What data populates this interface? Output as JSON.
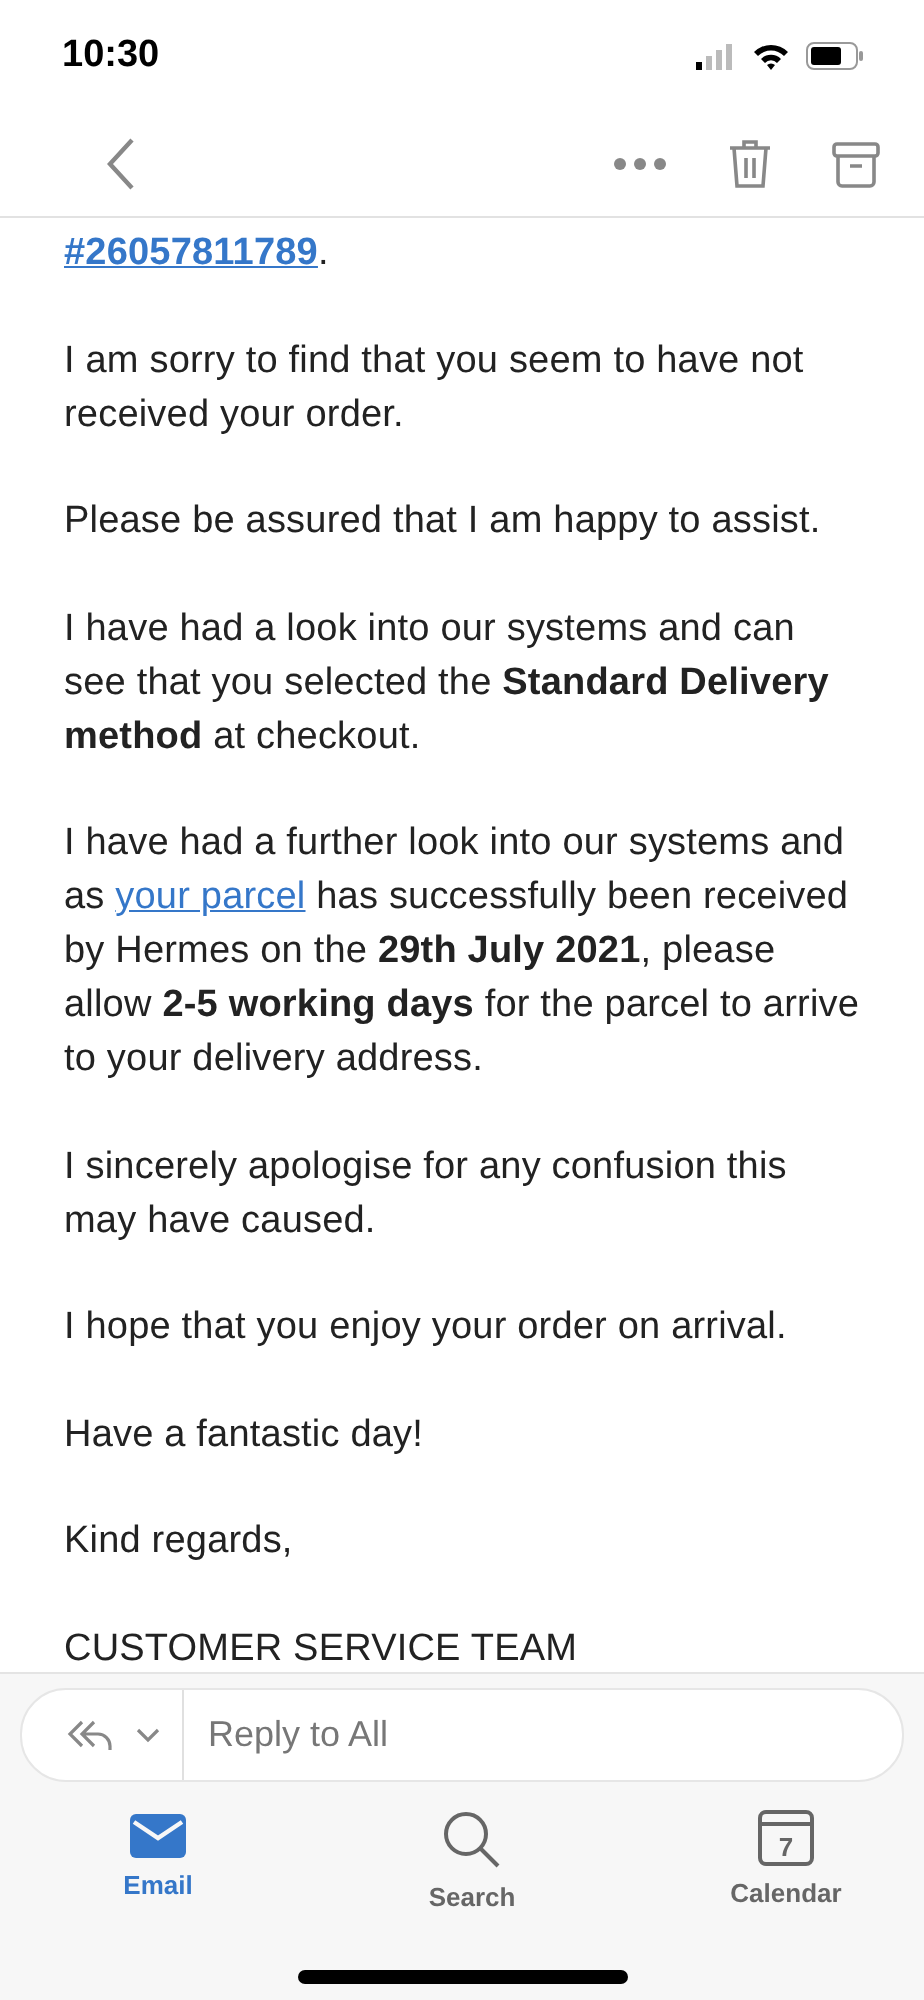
{
  "status_bar": {
    "time": "10:30"
  },
  "paragraphs": [
    [
      {
        "kind": "strong-link",
        "text": "#26057811789"
      },
      {
        "kind": "text",
        "text": "."
      }
    ],
    [
      {
        "kind": "text",
        "text": "I am sorry to find that you seem to have not received your order."
      }
    ],
    [
      {
        "kind": "text",
        "text": "Please be assured that I am happy to assist."
      }
    ],
    [
      {
        "kind": "text",
        "text": "I have had a look into our systems and can see that you selected the **Standard Delivery method** at checkout."
      }
    ],
    [
      {
        "kind": "text",
        "text": "I have had a further look into our systems and as "
      },
      {
        "kind": "link",
        "text": "your parcel"
      },
      {
        "kind": "text",
        "text": " has successfully been received by Hermes on the **29th July 2021**, please allow **2-5 working days** for the parcel to arrive to your delivery address."
      }
    ],
    [
      {
        "kind": "text",
        "text": "I sincerely apologise for any confusion this may have caused."
      }
    ],
    [
      {
        "kind": "text",
        "text": "I hope that you enjoy your order on arrival."
      }
    ],
    [
      {
        "kind": "text",
        "text": "Have a fantastic day!"
      }
    ],
    [
      {
        "kind": "text",
        "text": "Kind regards,"
      }
    ],
    [
      {
        "kind": "text",
        "text": "CUSTOMER SERVICE TEAM"
      }
    ]
  ],
  "reply": {
    "placeholder": "Reply to All"
  },
  "tabs": [
    {
      "label": "Email",
      "kind": "email",
      "selected": true
    },
    {
      "label": "Search",
      "kind": "search",
      "selected": false
    },
    {
      "label": "Calendar",
      "kind": "calendar",
      "selected": false,
      "day": "7"
    }
  ]
}
